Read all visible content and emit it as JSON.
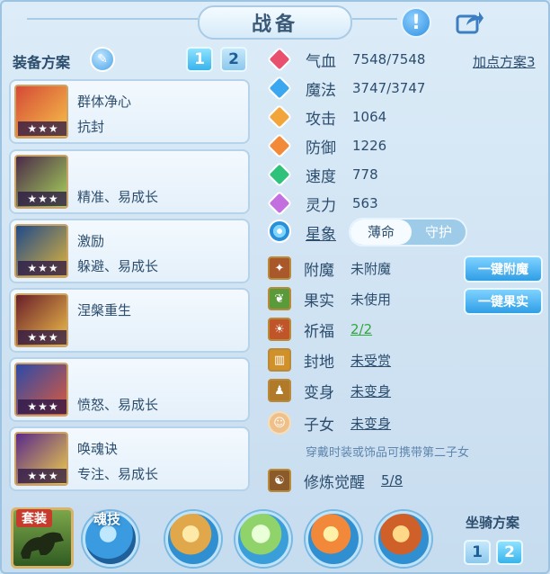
{
  "window": {
    "title": "战备"
  },
  "equip": {
    "label": "装备方案",
    "plan_buttons": [
      "1",
      "2"
    ],
    "cards": [
      {
        "line1": "群体净心",
        "line2": "抗封",
        "stars": "★★★"
      },
      {
        "line1": "",
        "line2": "精准、易成长",
        "stars": "★★★"
      },
      {
        "line1": "激励",
        "line2": "躲避、易成长",
        "stars": "★★★"
      },
      {
        "line1": "涅槃重生",
        "line2": "",
        "stars": "★★★"
      },
      {
        "line1": "",
        "line2": "愤怒、易成长",
        "stars": "★★★"
      },
      {
        "line1": "唤魂诀",
        "line2": "专注、易成长",
        "stars": "★★★"
      }
    ]
  },
  "stats": {
    "alloc_link": "加点方案3",
    "rows": [
      {
        "name": "气血",
        "value": "7548/7548",
        "color": "#e8506e"
      },
      {
        "name": "魔法",
        "value": "3747/3747",
        "color": "#3aa7f0"
      },
      {
        "name": "攻击",
        "value": "1064",
        "color": "#f2a53a"
      },
      {
        "name": "防御",
        "value": "1226",
        "color": "#f28a3a"
      },
      {
        "name": "速度",
        "value": "778",
        "color": "#2fc27a"
      },
      {
        "name": "灵力",
        "value": "563",
        "color": "#c46fe0"
      }
    ],
    "star_label": "星象",
    "toggle": [
      "薄命",
      "守护"
    ]
  },
  "features": [
    {
      "name": "附魔",
      "value": "未附魔",
      "underline": false
    },
    {
      "name": "果实",
      "value": "未使用",
      "underline": false
    },
    {
      "name": "祈福",
      "value": "2/2",
      "underline": true,
      "green": true
    },
    {
      "name": "封地",
      "value": "未受赏",
      "underline": true
    },
    {
      "name": "变身",
      "value": "未变身",
      "underline": true
    },
    {
      "name": "子女",
      "value": "未变身",
      "underline": true
    }
  ],
  "buttons": {
    "enchant": "一键附魔",
    "fruit": "一键果实"
  },
  "hint": "穿戴时装或饰品可携带第二子女",
  "cultivation": {
    "name": "修炼觉醒",
    "value": "5/8"
  },
  "bottom": {
    "suit": "套装",
    "soul": "魂技",
    "mount_label": "坐骑方案",
    "mount_buttons": [
      "1",
      "2"
    ]
  }
}
